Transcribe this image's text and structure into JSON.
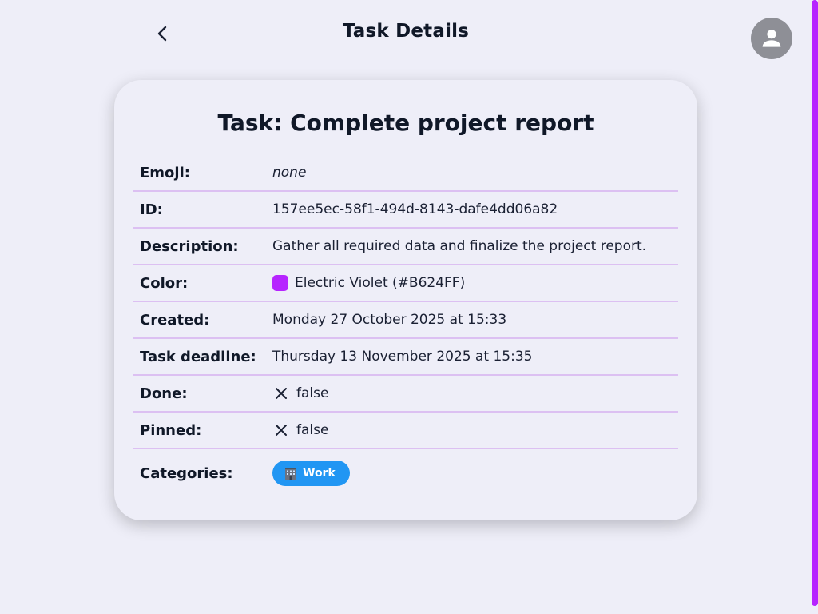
{
  "header": {
    "title": "Task Details",
    "back_icon": "chevron-left-icon",
    "avatar_icon": "person-icon"
  },
  "card": {
    "title": "Task: Complete project report",
    "rows": {
      "emoji": {
        "label": "Emoji:",
        "value": "none"
      },
      "id": {
        "label": "ID:",
        "value": "157ee5ec-58f1-494d-8143-dafe4dd06a82"
      },
      "description": {
        "label": "Description:",
        "value": "Gather all required data and finalize the project report."
      },
      "color": {
        "label": "Color:",
        "value": "Electric Violet (#B624FF)",
        "swatch": "#B624FF"
      },
      "created": {
        "label": "Created:",
        "value": "Monday 27 October 2025 at 15:33"
      },
      "deadline": {
        "label": "Task deadline:",
        "value": "Thursday 13 November 2025 at 15:35"
      },
      "done": {
        "label": "Done:",
        "value": "false",
        "icon": "close-icon"
      },
      "pinned": {
        "label": "Pinned:",
        "value": "false",
        "icon": "close-icon"
      },
      "categories": {
        "label": "Categories:",
        "items": [
          {
            "name": "Work",
            "icon": "office-building-icon",
            "color": "#2196F3"
          }
        ]
      }
    }
  },
  "colors": {
    "background": "#EEEEF8",
    "accent": "#B624FF",
    "divider": "#DCC0F2",
    "avatar": "#8E8F96"
  }
}
